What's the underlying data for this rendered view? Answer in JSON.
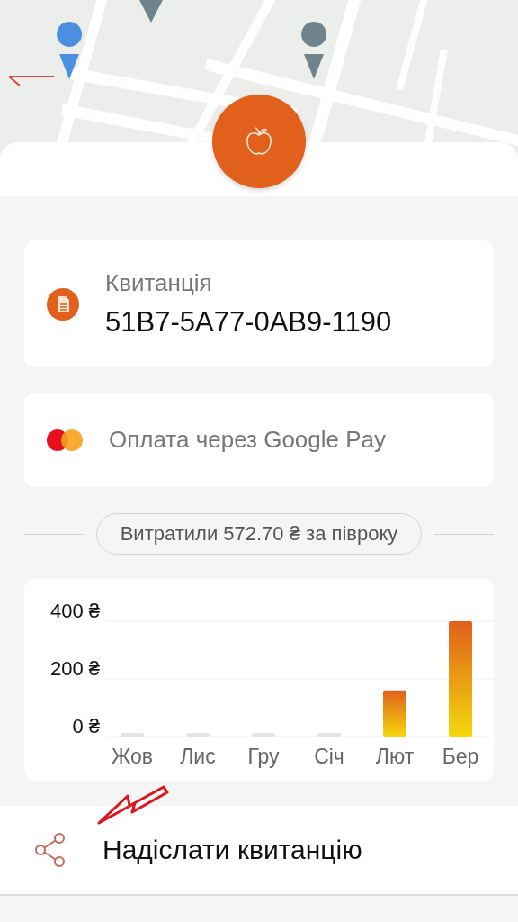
{
  "receipt_card": {
    "label": "Квитанція",
    "number": "51B7-5A77-0AB9-1190"
  },
  "payment_card": {
    "text": "Оплата через Google Pay"
  },
  "summary": {
    "text": "Витратили 572.70 ₴ за півроку"
  },
  "chart": {
    "chart_data": {
      "type": "bar",
      "categories": [
        "Жов",
        "Лис",
        "Гру",
        "Січ",
        "Лют",
        "Бер"
      ],
      "series": [
        {
          "color": "#e0601c",
          "values": [
            0,
            0,
            0,
            0,
            160,
            400
          ]
        }
      ],
      "ylim": [
        0,
        400
      ],
      "yticks": [
        {
          "value": 0,
          "label": "0 ₴"
        },
        {
          "value": 200,
          "label": "200 ₴"
        },
        {
          "value": 400,
          "label": "400 ₴"
        }
      ]
    }
  },
  "actions": [
    {
      "kind": "share",
      "label": "Надіслати квитанцію"
    }
  ]
}
